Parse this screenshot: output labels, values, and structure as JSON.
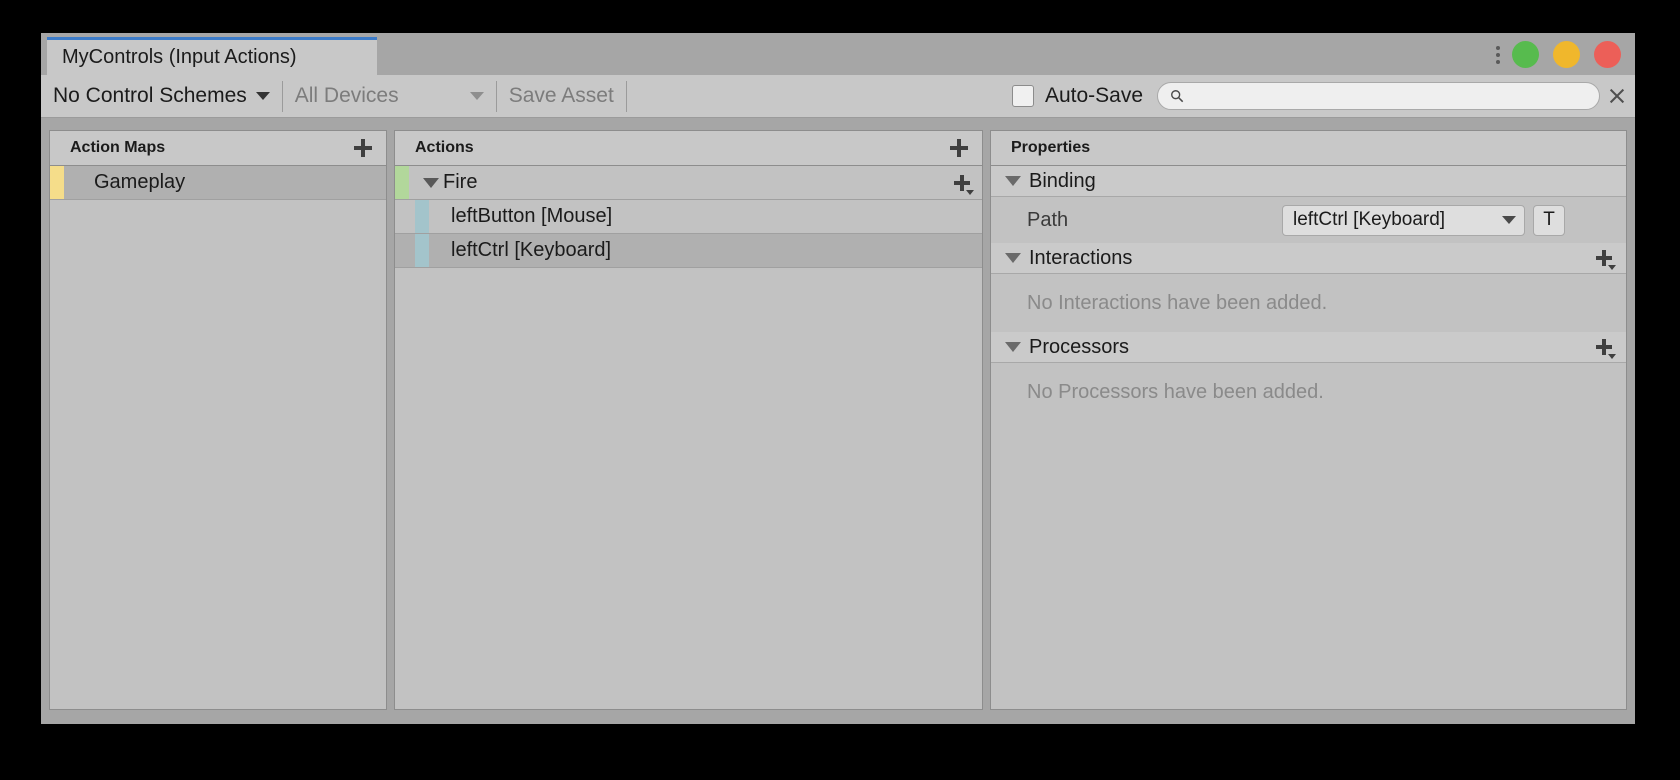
{
  "window": {
    "tab_label": "MyControls (Input Actions)",
    "menu_icon": "vertical-dots-icon",
    "traffic_lights": [
      {
        "name": "maximize",
        "color": "#57bb4e"
      },
      {
        "name": "minimize",
        "color": "#f0b72c"
      },
      {
        "name": "close",
        "color": "#ec5f58"
      }
    ]
  },
  "toolbar": {
    "control_schemes": "No Control Schemes",
    "devices": "All Devices",
    "save_asset": "Save Asset",
    "autosave_label": "Auto-Save",
    "autosave_checked": false,
    "search_value": "",
    "search_placeholder": "",
    "search_icon": "search-icon",
    "clear_icon": "close-icon"
  },
  "action_maps": {
    "title": "Action Maps",
    "add_label": "+",
    "items": [
      {
        "label": "Gameplay",
        "selected": true,
        "color": "#f5dd8a"
      }
    ]
  },
  "actions": {
    "title": "Actions",
    "add_label": "+",
    "items": [
      {
        "label": "Fire",
        "type": "action",
        "expanded": true,
        "selected": false,
        "color": "#b2d79b"
      },
      {
        "label": "leftButton [Mouse]",
        "type": "binding",
        "selected": false,
        "color": "#a3c4cb"
      },
      {
        "label": "leftCtrl [Keyboard]",
        "type": "binding",
        "selected": true,
        "color": "#a3c4cb"
      }
    ]
  },
  "properties": {
    "title": "Properties",
    "binding": {
      "section_label": "Binding",
      "expanded": true,
      "path_label": "Path",
      "path_value": "leftCtrl [Keyboard]",
      "text_mode_button": "T"
    },
    "interactions": {
      "section_label": "Interactions",
      "expanded": true,
      "empty_text": "No Interactions have been added."
    },
    "processors": {
      "section_label": "Processors",
      "expanded": true,
      "empty_text": "No Processors have been added."
    }
  }
}
